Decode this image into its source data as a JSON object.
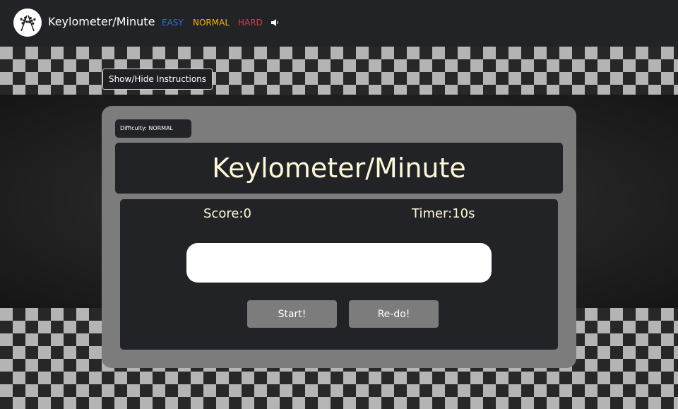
{
  "navbar": {
    "brand": "Keylometer/Minute",
    "logo_icon": "checkered-flags-icon",
    "difficulties": {
      "easy": "EASY",
      "normal": "NORMAL",
      "hard": "HARD"
    },
    "sound_icon": "speaker-icon",
    "colors": {
      "easy": "#2f6fe0",
      "normal": "#f5b800",
      "hard": "#d43b4a"
    }
  },
  "instructions_button": "Show/Hide Instructions",
  "game": {
    "difficulty_label": "Difficulty: NORMAL",
    "title": "Keylometer/Minute",
    "score": "Score:0",
    "timer": "Timer:10s",
    "input_value": "",
    "input_placeholder": "",
    "start_label": "Start!",
    "redo_label": "Re-do!"
  }
}
